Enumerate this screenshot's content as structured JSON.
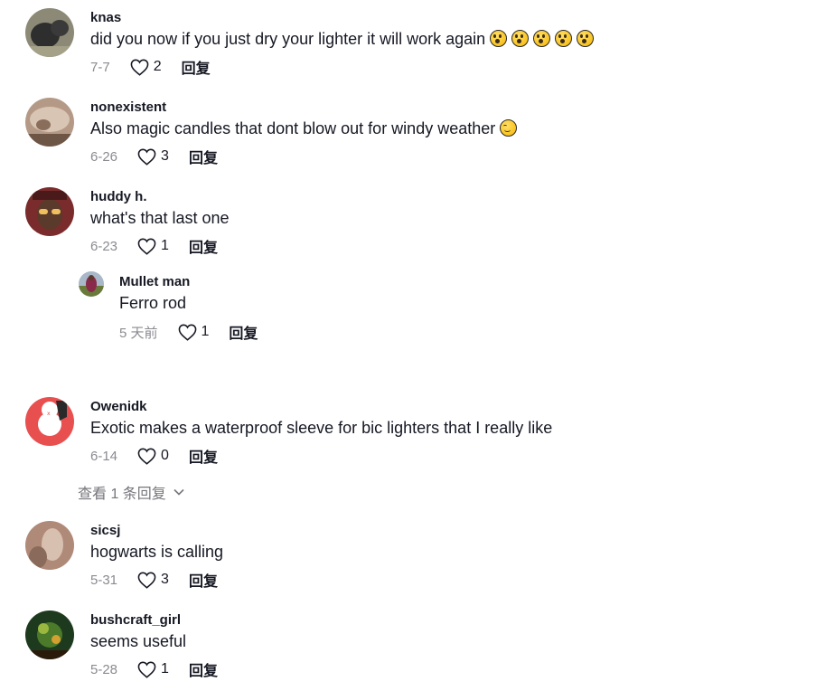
{
  "comments": [
    {
      "username": "knas",
      "text": "did you now if you just dry your lighter it will work again",
      "emoji": [
        "wow",
        "wow",
        "wow",
        "wow",
        "wow"
      ],
      "date": "7-7",
      "likes": "2",
      "reply": "回复"
    },
    {
      "username": "nonexistent",
      "text": "Also magic candles that dont blow out for windy weather",
      "emoji": [
        "smile"
      ],
      "date": "6-26",
      "likes": "3",
      "reply": "回复"
    },
    {
      "username": "huddy h.",
      "text": "what's that last one",
      "date": "6-23",
      "likes": "1",
      "reply": "回复"
    },
    {
      "username": "Mullet man",
      "text": "Ferro rod",
      "date": "5 天前",
      "likes": "1",
      "reply": "回复"
    },
    {
      "username": "Owenidk",
      "text": "Exotic makes a waterproof sleeve for bic lighters that I really like",
      "date": "6-14",
      "likes": "0",
      "reply": "回复"
    },
    {
      "username": "sicsj",
      "text": "hogwarts is calling",
      "date": "5-31",
      "likes": "3",
      "reply": "回复"
    },
    {
      "username": "bushcraft_girl",
      "text": "seems useful",
      "date": "5-28",
      "likes": "1",
      "reply": "回复"
    }
  ],
  "view_replies": "查看 1 条回复",
  "colors": {
    "date": "#8a8b91",
    "text": "#161823",
    "view_replies": "#75767c"
  }
}
